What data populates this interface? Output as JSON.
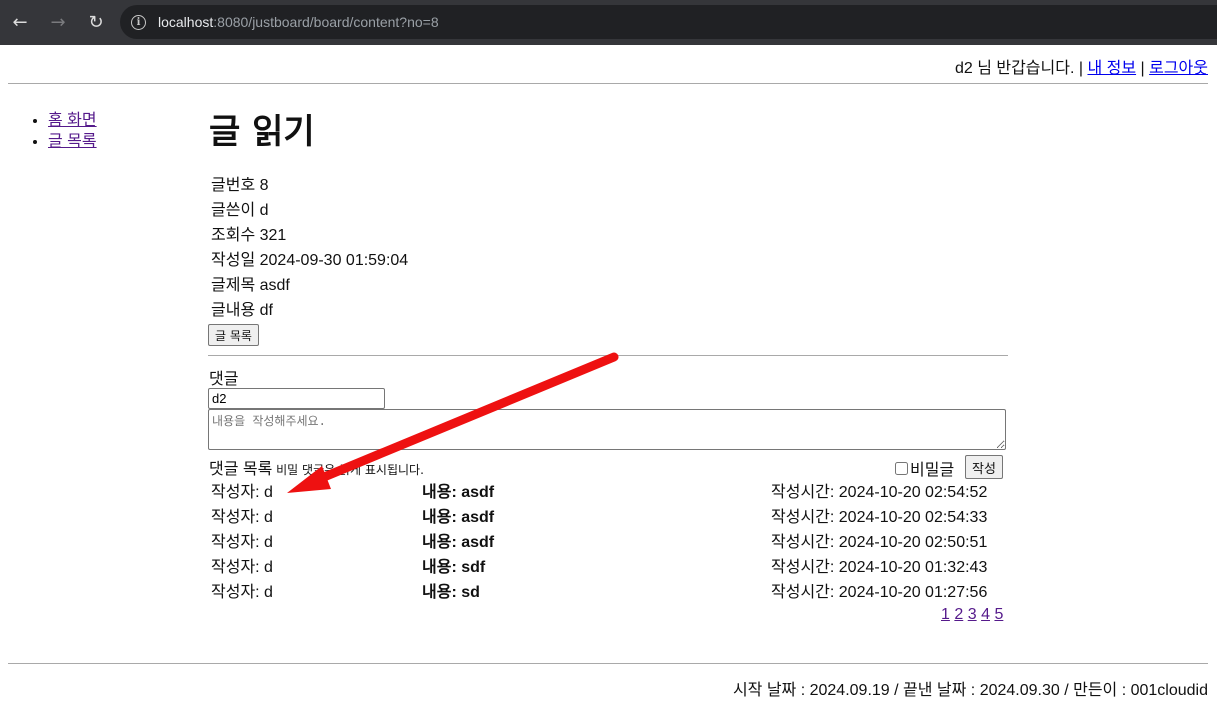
{
  "browser": {
    "url_host": "localhost",
    "url_path": ":8080/justboard/board/content?no=8"
  },
  "header": {
    "greeting": "d2 님 반갑습니다. | ",
    "my_info": "내 정보",
    "separator": " | ",
    "logout": "로그아웃"
  },
  "sidebar": {
    "items": [
      {
        "label": "홈 화면"
      },
      {
        "label": "글 목록"
      }
    ]
  },
  "main": {
    "title": "글 읽기",
    "meta": [
      {
        "label": "글번호",
        "value": "8"
      },
      {
        "label": "글쓴이",
        "value": "d"
      },
      {
        "label": "조회수",
        "value": "321"
      },
      {
        "label": "작성일",
        "value": "2024-09-30 01:59:04"
      },
      {
        "label": "글제목",
        "value": "asdf"
      },
      {
        "label": "글내용",
        "value": "df"
      }
    ],
    "list_button": "글 목록"
  },
  "comment_form": {
    "label": "댓글",
    "writer_value": "d2",
    "content_placeholder": "내용을 작성해주세요.",
    "list_title": "댓글 목록",
    "hint": " 비밀 댓글은 굵게 표시됩니다.",
    "secret_label": "비밀글",
    "submit_label": "작성"
  },
  "comments": [
    {
      "writer": "작성자: d",
      "content_label": "내용: ",
      "content": "asdf",
      "time": "작성시간: 2024-10-20 02:54:52"
    },
    {
      "writer": "작성자: d",
      "content_label": "내용: ",
      "content": "asdf",
      "time": "작성시간: 2024-10-20 02:54:33"
    },
    {
      "writer": "작성자: d",
      "content_label": "내용: ",
      "content": "asdf",
      "time": "작성시간: 2024-10-20 02:50:51"
    },
    {
      "writer": "작성자: d",
      "content_label": "내용: ",
      "content": "sdf",
      "time": "작성시간: 2024-10-20 01:32:43"
    },
    {
      "writer": "작성자: d",
      "content_label": "내용: ",
      "content": "sd",
      "time": "작성시간: 2024-10-20 01:27:56"
    }
  ],
  "pagination": [
    "1",
    "2",
    "3",
    "4",
    "5"
  ],
  "footer": {
    "text": "시작 날짜 : 2024.09.19 / 끝낸 날짜 : 2024.09.30 / 만든이 : 001cloudid"
  },
  "colors": {
    "annotation_arrow": "#ee1111",
    "chrome_bg": "#35363a"
  }
}
